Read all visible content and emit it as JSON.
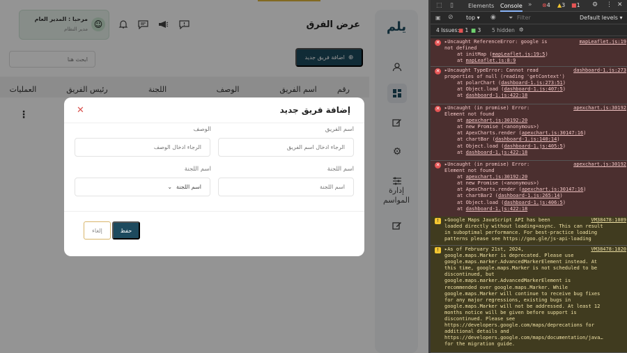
{
  "app": {
    "header": {
      "greeting": "مرحبا : المدير العام",
      "role": "مدير النظام",
      "avatar_icon": "avatar-icon",
      "icons": [
        "bell-icon",
        "chat-icon",
        "megaphone-icon",
        "chat-alert-icon"
      ]
    },
    "logo_text": "يلم",
    "page_title": "عرض الفرق",
    "add_team_button": "اضافة فريق جديد",
    "search_placeholder": "ابحث هنا",
    "table": {
      "columns": [
        "رقم",
        "اسم الفريق",
        "الوصف",
        "اللجنة",
        "رئيس الفريق",
        "العمليات"
      ]
    },
    "sidebar": {
      "seasons_label": "إدارة المواسم",
      "icons": [
        "user-icon",
        "dashboard-icon",
        "edit-icon",
        "gear-icon",
        "sliders-icon",
        "edit-icon-2"
      ]
    }
  },
  "modal": {
    "title": "إضافة فريق جديد",
    "fields": {
      "team_name_label": "اسم الفريق",
      "team_name_placeholder": "الرجاء ادخال اسم الفريق",
      "description_label": "الوصف",
      "description_placeholder": "الرجاء ادخال الوصف",
      "committee_label": "اسم اللجنة",
      "committee_placeholder": "اسم اللجنة",
      "committee_name_label": "اسم اللجنة",
      "committee_select_value": "اسم اللجنة"
    },
    "save_button": "حفظ",
    "cancel_button": "إلغاء"
  },
  "devtools": {
    "tabs": [
      "Elements",
      "Console"
    ],
    "error_count": "4",
    "warning_count": "3",
    "info_count": "1",
    "context": "top",
    "filter_placeholder": "Filter",
    "levels": "Default levels",
    "issues_label": "4 Issues:",
    "issues_err": "1",
    "issues_warn": "3",
    "hidden": "5 hidden",
    "messages": [
      {
        "type": "error",
        "source": "mapLeaflet.js:19",
        "lines": [
          "▸Uncaught ReferenceError: google is",
          "not defined"
        ],
        "stack": [
          [
            "at initMap ",
            "mapLeaflet.js:19:5"
          ],
          [
            "at ",
            "mapLeaflet.js:8:9"
          ]
        ]
      },
      {
        "type": "error",
        "source": "dashboard-1.js:273",
        "lines": [
          "▸Uncaught TypeError: Cannot read",
          "properties of null (reading 'getContext')"
        ],
        "stack": [
          [
            "at polarChart ",
            "dashboard-1.js:273:51"
          ],
          [
            "at Object.load ",
            "dashboard-1.js:407:5"
          ],
          [
            "at ",
            "dashboard-1.js:422:18"
          ]
        ]
      },
      {
        "type": "error",
        "source": "apexchart.js:30192",
        "lines": [
          "▸Uncaught (in promise) Error:",
          "Element not found"
        ],
        "stack": [
          [
            "at ",
            "apexchart.js:30192:20"
          ],
          [
            "at new Promise (<anonymous>)",
            ""
          ],
          [
            "at ApexCharts.render ",
            "apexchart.js:30147:16"
          ],
          [
            "at chartBar ",
            "dashboard-1.js:140:14"
          ],
          [
            "at Object.load ",
            "dashboard-1.js:405:5"
          ],
          [
            "at ",
            "dashboard-1.js:422:18"
          ]
        ]
      },
      {
        "type": "error",
        "source": "apexchart.js:30192",
        "lines": [
          "▸Uncaught (in promise) Error:",
          "Element not found"
        ],
        "stack": [
          [
            "at ",
            "apexchart.js:30192:20"
          ],
          [
            "at new Promise (<anonymous>)",
            ""
          ],
          [
            "at ApexCharts.render ",
            "apexchart.js:30147:16"
          ],
          [
            "at chartBar2 ",
            "dashboard-1.js:265:14"
          ],
          [
            "at Object.load ",
            "dashboard-1.js:406:5"
          ],
          [
            "at ",
            "dashboard-1.js:422:18"
          ]
        ]
      },
      {
        "type": "warning",
        "source": "VM38478:1089",
        "lines": [
          "▸Google Maps JavaScript API has been",
          "loaded directly without loading=async. This can result",
          "in suboptimal performance. For best-practice loading",
          "patterns please see https://goo.gle/js-api-loading"
        ],
        "stack": []
      },
      {
        "type": "warning",
        "source": "VM38478:1020",
        "lines": [
          "▸As of February 21st, 2024,",
          "google.maps.Marker is deprecated. Please use",
          "google.maps.marker.AdvancedMarkerElement instead. At",
          "this time, google.maps.Marker is not scheduled to be",
          "discontinued, but",
          "google.maps.marker.AdvancedMarkerElement is",
          "recommended over google.maps.Marker. While",
          "google.maps.Marker will continue to receive bug fixes",
          "for any major regressions, existing bugs in",
          "google.maps.Marker will not be addressed. At least 12",
          "months notice will be given before support is",
          "discontinued. Please see",
          "https://developers.google.com/maps/deprecations for",
          "additional details and",
          "https://developers.google.com/maps/documentation/java…",
          "for the migration guide."
        ],
        "stack": []
      }
    ]
  },
  "colors": {
    "primary": "#1d4a5e",
    "accent": "#e0b53a",
    "close": "#d9534f"
  }
}
